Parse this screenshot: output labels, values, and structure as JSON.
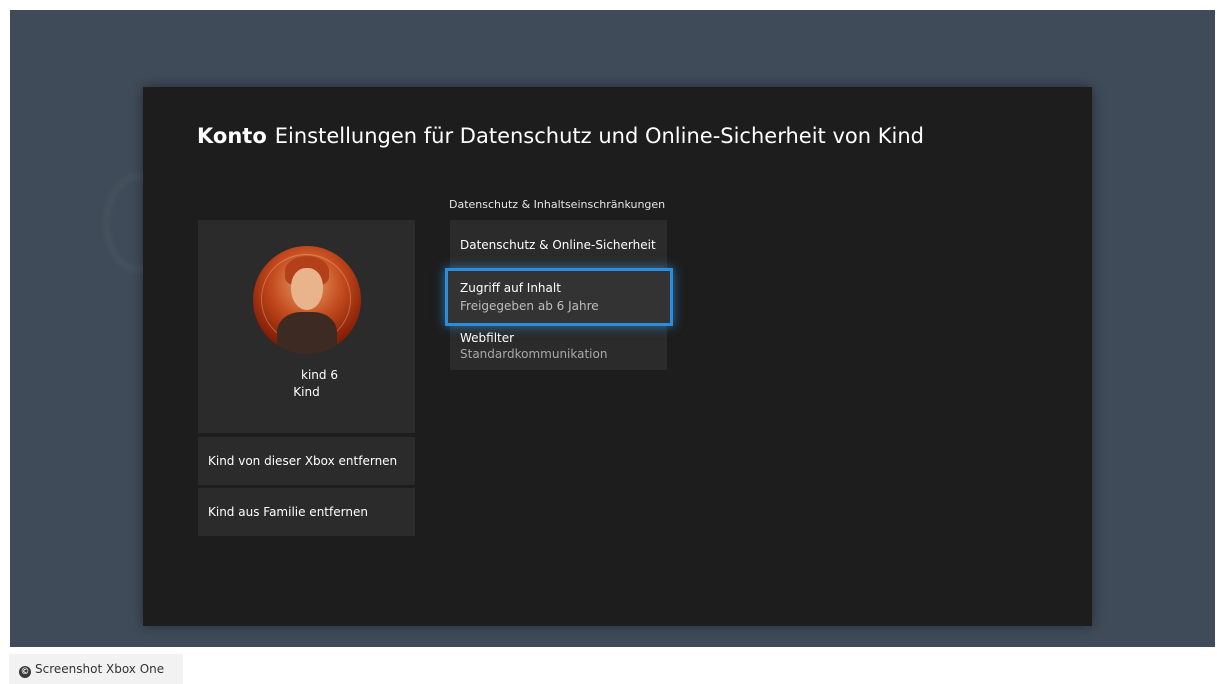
{
  "dialog": {
    "title_bold": "Konto",
    "title_rest": "Einstellungen für Datenschutz und Online-Sicherheit von Kind"
  },
  "profile": {
    "gamertag": "kind 6",
    "role": "Kind"
  },
  "actions": {
    "remove_from_xbox": "Kind von dieser Xbox entfernen",
    "remove_from_family": "Kind aus Familie entfernen"
  },
  "privacy_section": {
    "heading": "Datenschutz & Inhaltseinschränkungen",
    "items": [
      {
        "label": "Datenschutz & Online-Sicherheit",
        "sub": ""
      },
      {
        "label": "Zugriff auf Inhalt",
        "sub": "Freigegeben ab 6 Jahre",
        "focused": true
      },
      {
        "label": "Webfilter",
        "sub": "Standardkommunikation"
      }
    ]
  },
  "caption": {
    "icon": "copyright-icon",
    "text": "Screenshot Xbox One"
  },
  "colors": {
    "backdrop": "#3f4b58",
    "dialog": "#1d1d1d",
    "tile": "#2b2b2b",
    "focus_accent": "#2c8ddb"
  }
}
